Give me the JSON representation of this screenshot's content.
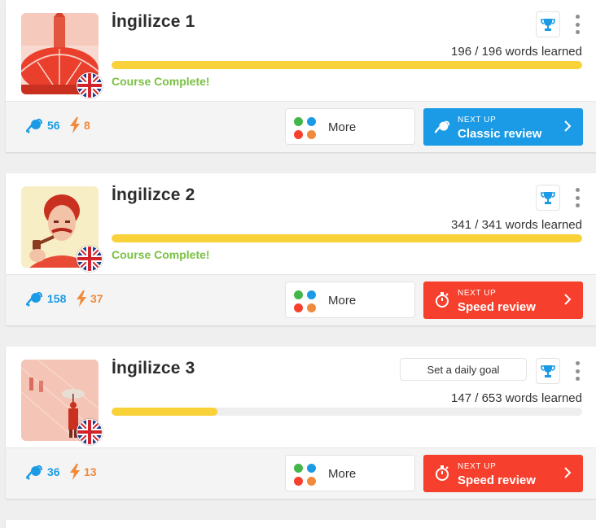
{
  "colors": {
    "accent_blue": "#1b9be5",
    "accent_red": "#f6402d",
    "progress_yellow": "#f9d139",
    "complete_green": "#7ac143",
    "bolt_orange": "#f08a3c"
  },
  "courses": [
    {
      "title": "İngilizce 1",
      "words_text": "196 / 196 words learned",
      "progress": 1.0,
      "status": "Course Complete!",
      "goal_button": "",
      "stats": {
        "water": "56",
        "bolt": "8"
      },
      "more_label": "More",
      "next": {
        "kicker": "NEXT UP",
        "label": "Classic review",
        "color": "#1b9be5",
        "icon": "watering-can-icon"
      }
    },
    {
      "title": "İngilizce 2",
      "words_text": "341 / 341 words learned",
      "progress": 1.0,
      "status": "Course Complete!",
      "goal_button": "",
      "stats": {
        "water": "158",
        "bolt": "37"
      },
      "more_label": "More",
      "next": {
        "kicker": "NEXT UP",
        "label": "Speed review",
        "color": "#f6402d",
        "icon": "stopwatch-icon"
      }
    },
    {
      "title": "İngilizce 3",
      "words_text": "147 / 653 words learned",
      "progress": 0.225,
      "status": "",
      "goal_button": "Set a daily goal",
      "stats": {
        "water": "36",
        "bolt": "13"
      },
      "more_label": "More",
      "next": {
        "kicker": "NEXT UP",
        "label": "Speed review",
        "color": "#f6402d",
        "icon": "stopwatch-icon"
      }
    }
  ]
}
